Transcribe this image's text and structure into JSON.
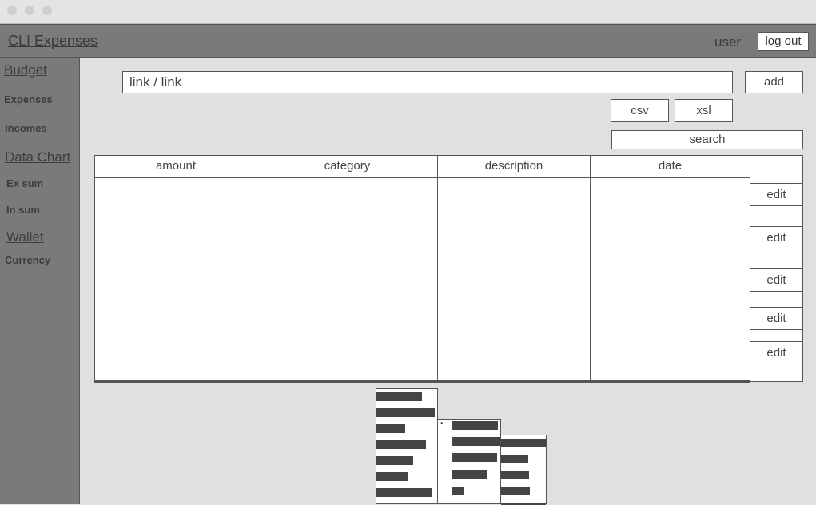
{
  "window": {
    "controls": [
      "close",
      "minimize",
      "maximize"
    ]
  },
  "header": {
    "title": "CLI Expenses",
    "user": "user",
    "logout_label": "log out"
  },
  "sidebar": {
    "items": [
      {
        "label": "Budget"
      },
      {
        "label": "Expenses"
      },
      {
        "label": "Incomes"
      },
      {
        "label": "Data Chart"
      },
      {
        "label": "Ex sum"
      },
      {
        "label": "In sum"
      },
      {
        "label": "Wallet"
      },
      {
        "label": "Currency"
      }
    ]
  },
  "toolbar": {
    "link_value": "link / link",
    "add_label": "add",
    "csv_label": "csv",
    "xsl_label": "xsl",
    "search_label": "search"
  },
  "table": {
    "columns": [
      "amount",
      "category",
      "description",
      "date"
    ],
    "actions": [
      "edit",
      "edit",
      "edit",
      "edit",
      "edit"
    ]
  },
  "colors": {
    "sidebar_bg": "#7a7a7a",
    "main_bg": "#e0e0e0",
    "border": "#555555",
    "placeholder_bar": "#444444"
  },
  "icons": [
    "bullet-icon"
  ]
}
